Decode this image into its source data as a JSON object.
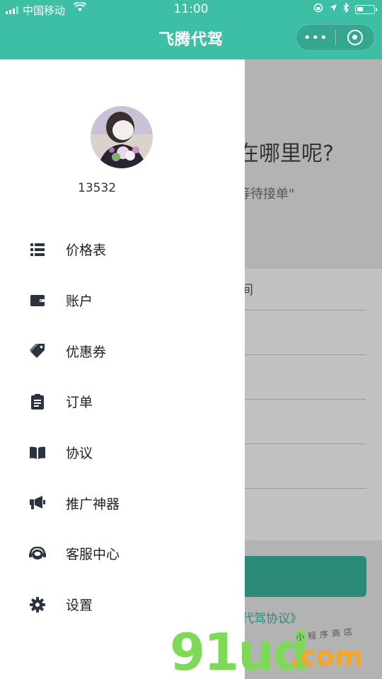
{
  "status_bar": {
    "carrier": "中国移动",
    "time": "11:00"
  },
  "nav": {
    "title": "飞腾代驾",
    "more_label": "•••",
    "close_label": ""
  },
  "background": {
    "question": "在哪里呢?",
    "waiting": "等待接单\"",
    "panel_label": "间",
    "agreement_link": "代驾协议》"
  },
  "drawer": {
    "phone": "13532",
    "menu": [
      {
        "label": "价格表",
        "icon": "list-icon"
      },
      {
        "label": "账户",
        "icon": "wallet-icon"
      },
      {
        "label": "优惠券",
        "icon": "tag-icon"
      },
      {
        "label": "订单",
        "icon": "clipboard-icon"
      },
      {
        "label": "协议",
        "icon": "book-icon"
      },
      {
        "label": "推广神器",
        "icon": "megaphone-icon"
      },
      {
        "label": "客服中心",
        "icon": "headset-icon"
      },
      {
        "label": "设置",
        "icon": "gear-icon"
      }
    ]
  },
  "watermark": {
    "brand": "91ud",
    "domain": ".com",
    "tagline": "小程序商店"
  },
  "colors": {
    "header": "#3dbfa5",
    "accent_dark": "#2c8a7a",
    "watermark_green": "#7ed957",
    "watermark_orange": "#f5a623"
  }
}
